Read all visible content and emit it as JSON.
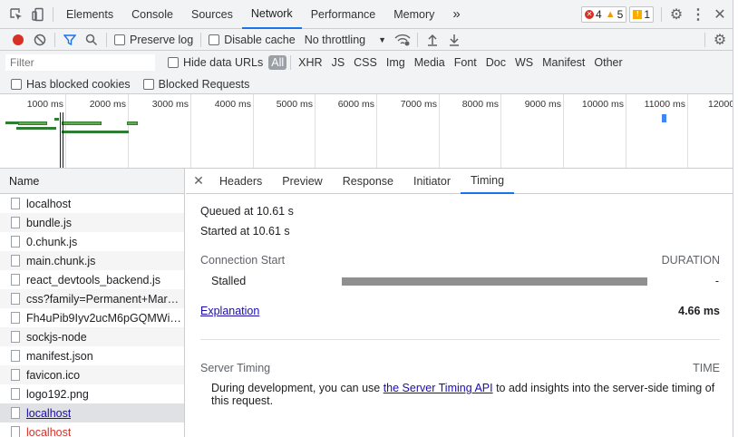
{
  "topbar": {
    "tabs": [
      "Elements",
      "Console",
      "Sources",
      "Network",
      "Performance",
      "Memory"
    ],
    "active_tab": "Network",
    "more": "»",
    "errors": "4",
    "warnings": "5",
    "info": "1"
  },
  "toolbar": {
    "preserve_log": "Preserve log",
    "disable_cache": "Disable cache",
    "throttling": "No throttling"
  },
  "filter": {
    "placeholder": "Filter",
    "hide_data_urls": "Hide data URLs",
    "types": [
      "All",
      "XHR",
      "JS",
      "CSS",
      "Img",
      "Media",
      "Font",
      "Doc",
      "WS",
      "Manifest",
      "Other"
    ],
    "has_blocked_cookies": "Has blocked cookies",
    "blocked_requests": "Blocked Requests"
  },
  "overview": {
    "ticks": [
      "1000 ms",
      "2000 ms",
      "3000 ms",
      "4000 ms",
      "5000 ms",
      "6000 ms",
      "7000 ms",
      "8000 ms",
      "9000 ms",
      "10000 ms",
      "11000 ms",
      "12000"
    ]
  },
  "list": {
    "header": "Name",
    "rows": [
      {
        "name": "localhost",
        "state": "normal"
      },
      {
        "name": "bundle.js",
        "state": "normal"
      },
      {
        "name": "0.chunk.js",
        "state": "normal"
      },
      {
        "name": "main.chunk.js",
        "state": "normal"
      },
      {
        "name": "react_devtools_backend.js",
        "state": "normal"
      },
      {
        "name": "css?family=Permanent+Mark…",
        "state": "normal"
      },
      {
        "name": "Fh4uPib9Iyv2ucM6pGQMWi…",
        "state": "normal"
      },
      {
        "name": "sockjs-node",
        "state": "normal"
      },
      {
        "name": "manifest.json",
        "state": "normal"
      },
      {
        "name": "favicon.ico",
        "state": "normal"
      },
      {
        "name": "logo192.png",
        "state": "normal"
      },
      {
        "name": "localhost",
        "state": "selected"
      },
      {
        "name": "localhost",
        "state": "error"
      }
    ]
  },
  "detail": {
    "tabs": [
      "Headers",
      "Preview",
      "Response",
      "Initiator",
      "Timing"
    ],
    "active_tab": "Timing",
    "queued": "Queued at 10.61 s",
    "started": "Started at 10.61 s",
    "connection_start": "Connection Start",
    "duration_label": "DURATION",
    "stalled": "Stalled",
    "stalled_value": "-",
    "explanation": "Explanation",
    "total": "4.66 ms",
    "server_timing": "Server Timing",
    "time_label": "TIME",
    "server_text_before": "During development, you can use ",
    "server_link": "the Server Timing API",
    "server_text_after": " to add insights into the server-side timing of this request."
  },
  "colors": {
    "accent": "#1a73e8",
    "record": "#d93025",
    "waterfall_green": "#2e7d32",
    "marker_blue": "#4285f4"
  }
}
